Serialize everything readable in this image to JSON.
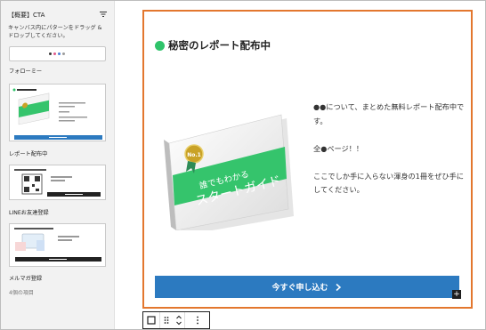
{
  "sidebar": {
    "title": "【概要】CTA",
    "description": "キャンバス内にパターンをドラッグ & ドロップしてください。",
    "patterns": [
      {
        "label": "フォローミー"
      },
      {
        "label": "レポート配布中"
      },
      {
        "label": "LINEお友達登録"
      },
      {
        "label": "メルマガ登録"
      }
    ],
    "count_text": "4個の項目",
    "dot_colors": [
      "#333333",
      "#e05a8a",
      "#4a7fd6",
      "#9b9b9b"
    ]
  },
  "canvas": {
    "heading": "秘密のレポート配布中",
    "book": {
      "title_line1": "誰でもわかる",
      "title_line2": "スタートガイド",
      "badge": "No.1"
    },
    "paragraphs": [
      "●●について、まとめた無料レポート配布中です。",
      "全●ページ！！",
      "ここでしか手に入らない渾身の1冊をぜひ手にしてください。"
    ],
    "cta_label": "今すぐ申し込む",
    "plus": "+"
  },
  "colors": {
    "accent_border": "#e3772e",
    "button": "#2c7ac0",
    "green": "#2fc36a"
  }
}
